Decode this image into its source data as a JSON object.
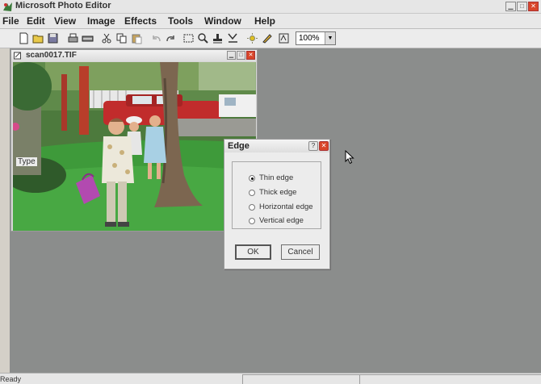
{
  "app": {
    "title": "Microsoft Photo Editor"
  },
  "menu": [
    "File",
    "Edit",
    "View",
    "Image",
    "Effects",
    "Tools",
    "Window",
    "Help"
  ],
  "toolbar": {
    "icons": [
      "new-icon",
      "open-icon",
      "save-icon",
      "print-icon",
      "scan-icon",
      "cut-icon",
      "copy-icon",
      "paste-icon",
      "undo-icon",
      "redo-icon",
      "select-icon",
      "zoom-icon",
      "stamp-icon",
      "crop-icon",
      "sun-icon",
      "pencil-icon",
      "smart-select-icon"
    ],
    "zoom_value": "100%"
  },
  "image_window": {
    "title": "scan0017.TIF"
  },
  "dialog": {
    "title": "Edge",
    "group_label": "Type",
    "options": [
      {
        "label": "Thin edge",
        "selected": true
      },
      {
        "label": "Thick edge",
        "selected": false
      },
      {
        "label": "Horizontal edge",
        "selected": false
      },
      {
        "label": "Vertical edge",
        "selected": false
      }
    ],
    "ok_label": "OK",
    "cancel_label": "Cancel",
    "help_label": "?"
  },
  "statusbar": {
    "text": "Ready"
  },
  "colors": {
    "workspace": "#8b8d8c",
    "close_button": "#d9462a",
    "dialog_bg": "#ececec"
  }
}
